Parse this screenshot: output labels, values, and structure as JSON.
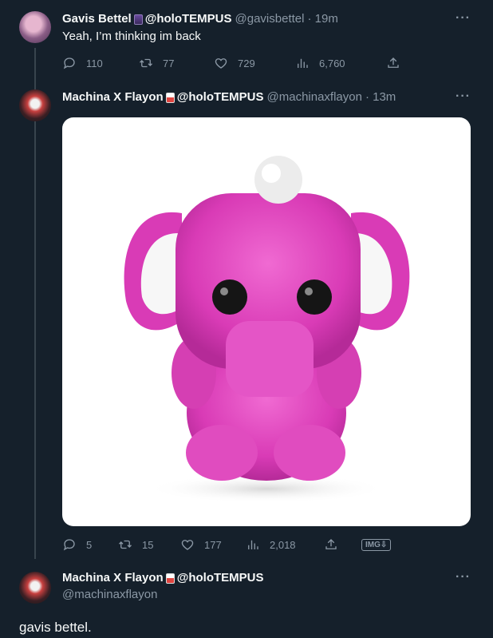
{
  "tweets": [
    {
      "name": "Gavis Bettel",
      "org": "@holoTEMPUS",
      "handle": "@gavisbettel",
      "time": "· 19m",
      "text": "Yeah, I’m thinking im back",
      "replies": "110",
      "retweets": "77",
      "likes": "729",
      "views": "6,760"
    },
    {
      "name": "Machina X Flayon",
      "org": "@holoTEMPUS",
      "handle": "@machinaxflayon",
      "time": "· 13m",
      "image_alt": "Pink plush elephant toy",
      "replies": "5",
      "retweets": "15",
      "likes": "177",
      "views": "2,018",
      "img_badge": "IMG⇩"
    },
    {
      "name": "Machina X Flayon",
      "org": "@holoTEMPUS",
      "handle": "@machinaxflayon",
      "text": "gavis bettel."
    }
  ],
  "more_label": "···",
  "colors": {
    "background": "#15202b",
    "muted": "#8b98a5",
    "text": "#f7f9f9",
    "plush_pink": "#e63fc0"
  },
  "icons": {
    "reply": "reply-icon",
    "retweet": "retweet-icon",
    "like": "heart-icon",
    "views": "views-icon",
    "share": "share-icon"
  }
}
